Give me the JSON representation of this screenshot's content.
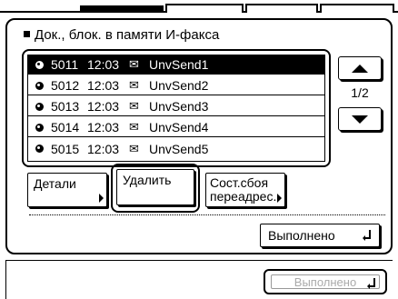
{
  "title": "Док., блок. в памяти И-факса",
  "list": {
    "rows": [
      {
        "num": "5011",
        "time": "12:03",
        "icon": "send-icon",
        "name": "UnvSend1",
        "selected": true
      },
      {
        "num": "5012",
        "time": "12:03",
        "icon": "send-icon",
        "name": "UnvSend2",
        "selected": false
      },
      {
        "num": "5013",
        "time": "12:03",
        "icon": "send-icon",
        "name": "UnvSend3",
        "selected": false
      },
      {
        "num": "5014",
        "time": "12:03",
        "icon": "send-icon",
        "name": "UnvSend4",
        "selected": false
      },
      {
        "num": "5015",
        "time": "12:03",
        "icon": "send-icon",
        "name": "UnvSend5",
        "selected": false
      }
    ]
  },
  "pager": {
    "indicator": "1/2"
  },
  "actions": {
    "details": "Детали",
    "delete": "Удалить",
    "resend_line1": "Сост.сбоя",
    "resend_line2": "переадрес."
  },
  "done_label": "Выполнено",
  "footer_done_label": "Выполнено"
}
